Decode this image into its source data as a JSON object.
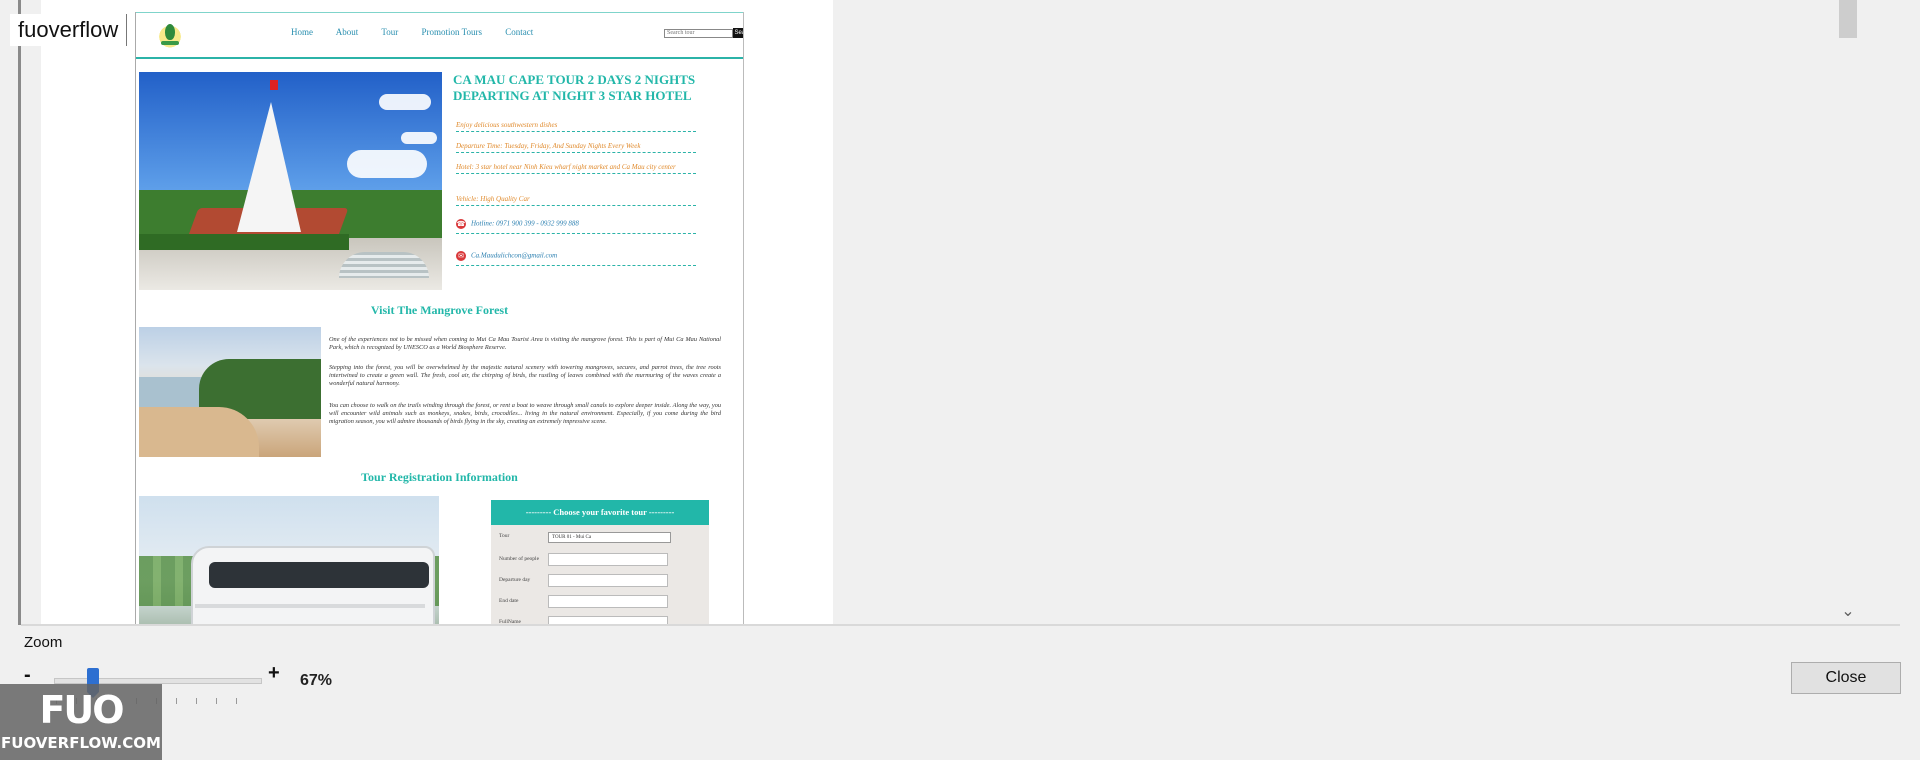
{
  "window": {
    "watermark": "fuoverflow"
  },
  "preview": {
    "nav": {
      "links": [
        "Home",
        "About",
        "Tour",
        "Promotion Tours",
        "Contact"
      ],
      "search_placeholder": "Search tour",
      "search_button": "Search"
    },
    "tour": {
      "title": "CA MAU CAPE TOUR 2 DAYS 2 NIGHTS DEPARTING AT NIGHT 3 STAR HOTEL",
      "info": [
        "Enjoy delicious southwestern dishes",
        "Departure Time: Tuesday, Friday, And Sunday Nights Every Week",
        "Hotel: 3 star hotel near Ninh Kieu wharf night market and Ca Mau city center",
        "Vehicle: High Quality Car"
      ],
      "hotline": "Hotline: 0971 900 399 - 0932 999 888",
      "email": "Ca.Maudulichcon@gmail.com"
    },
    "mangrove": {
      "title": "Visit The Mangrove Forest",
      "paragraphs": [
        "One of the experiences not to be missed when coming to Mui Ca Mau Tourist Area is visiting the mangrove forest. This is part of Mui Ca Mau National Park, which is recognized by UNESCO as a World Biosphere Reserve.",
        "Stepping into the forest, you will be overwhelmed by the majestic natural scenery with towering mangroves, secures, and parrot trees, the tree roots intertwined to create a green wall. The fresh, cool air, the chirping of birds, the rustling of leaves combined with the murmuring of the waves create a wonderful natural harmony.",
        "You can choose to walk on the trails winding through the forest, or rent a boat to weave through small canals to explore deeper inside. Along the way, you will encounter wild animals such as monkeys, snakes, birds, crocodiles... living in the natural environment. Especially, if you come during the bird migration season, you will admire thousands of birds flying in the sky, creating an extremely impressive scene."
      ]
    },
    "registration": {
      "title": "Tour Registration Information",
      "form_header": "--------- Choose your favorite tour ---------",
      "fields": {
        "tour_label": "Tour",
        "tour_value": "TOUR 01 - Mui Ca",
        "people_label": "Number of people",
        "departure_label": "Departure day",
        "end_label": "End date",
        "fullname_label": "FullName"
      }
    }
  },
  "controls": {
    "zoom_label": "Zoom",
    "minus": "-",
    "plus": "+",
    "zoom_value": "67%",
    "zoom_percent": 67,
    "close_label": "Close"
  },
  "logo": {
    "mark": "FUO",
    "sub": "FUOVERFLOW.COM"
  }
}
